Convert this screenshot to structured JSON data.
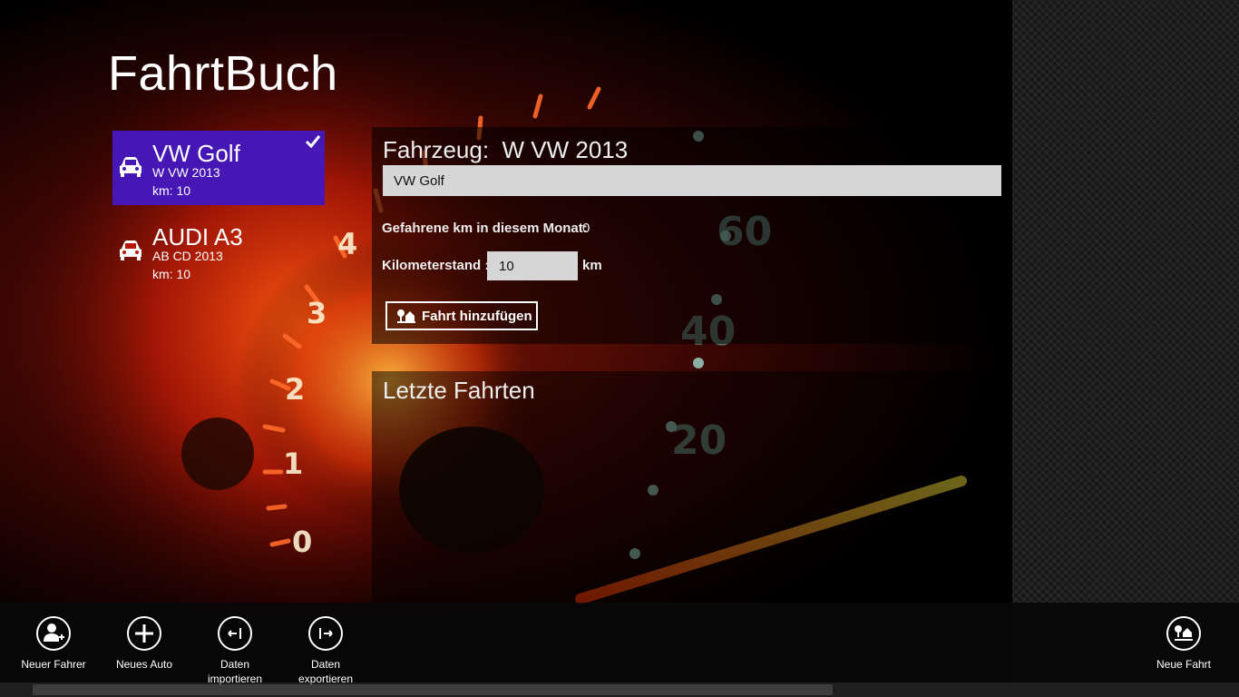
{
  "app": {
    "title": "FahrtBuch"
  },
  "cars": [
    {
      "name": "VW Golf",
      "plate": "W VW 2013",
      "km": "km:  10",
      "selected": true
    },
    {
      "name": "AUDI A3",
      "plate": "AB CD 2013",
      "km": "km:  10",
      "selected": false
    }
  ],
  "detail": {
    "vehicle_heading": "Fahrzeug:  W VW 2013",
    "name_value": "VW Golf",
    "monthly_km_label": "Gefahrene km in diesem Monat:",
    "monthly_km_value": "0",
    "odometer_label": "Kilometerstand :",
    "odometer_value": "10",
    "odometer_unit": "km",
    "add_trip_label": "Fahrt hinzufügen"
  },
  "trips": {
    "heading": "Letzte Fahrten"
  },
  "app_bar": {
    "new_driver": "Neuer Fahrer",
    "new_car": "Neues Auto",
    "import_line1": "Daten",
    "import_line2": "importieren",
    "export_line1": "Daten",
    "export_line2": "exportieren",
    "new_trip": "Neue Fahrt"
  },
  "icons": {
    "car": "car-icon",
    "check": "check-icon",
    "add_trip": "trip-icon",
    "new_driver": "add-user-icon",
    "new_car": "plus-icon",
    "import": "import-icon",
    "export": "export-icon",
    "new_trip": "trip-icon"
  },
  "colors": {
    "accent": "#4617b4",
    "input_bg": "#d6d6d6",
    "app_bar": "#080808"
  }
}
